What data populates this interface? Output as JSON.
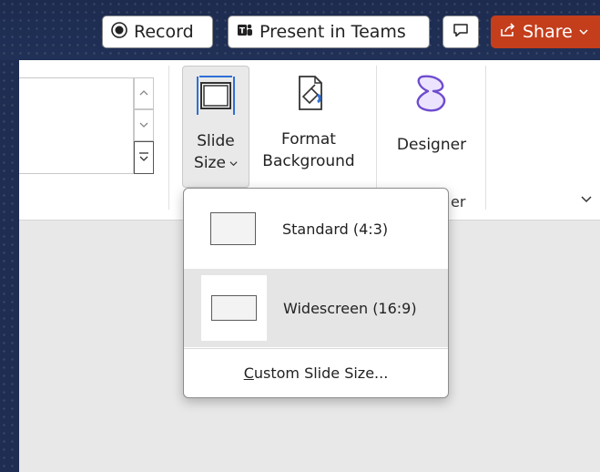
{
  "toolbar": {
    "record_label": "Record",
    "present_label": "Present in Teams",
    "share_label": "Share"
  },
  "ribbon": {
    "slide_size": {
      "line1": "Slide",
      "line2": "Size"
    },
    "format_background": {
      "line1": "Format",
      "line2": "Background"
    },
    "designer_label": "Designer",
    "group_label_partial": "er"
  },
  "menu": {
    "standard_label": "Standard (4:3)",
    "widescreen_label": "Widescreen (16:9)",
    "custom_label_accel": "C",
    "custom_label_rest": "ustom Slide Size..."
  },
  "colors": {
    "share_bg": "#c43e1c",
    "title_bg": "#1f2d52",
    "slide_icon_blue": "#2f6fd6",
    "designer_purple": "#6f4ccf"
  }
}
